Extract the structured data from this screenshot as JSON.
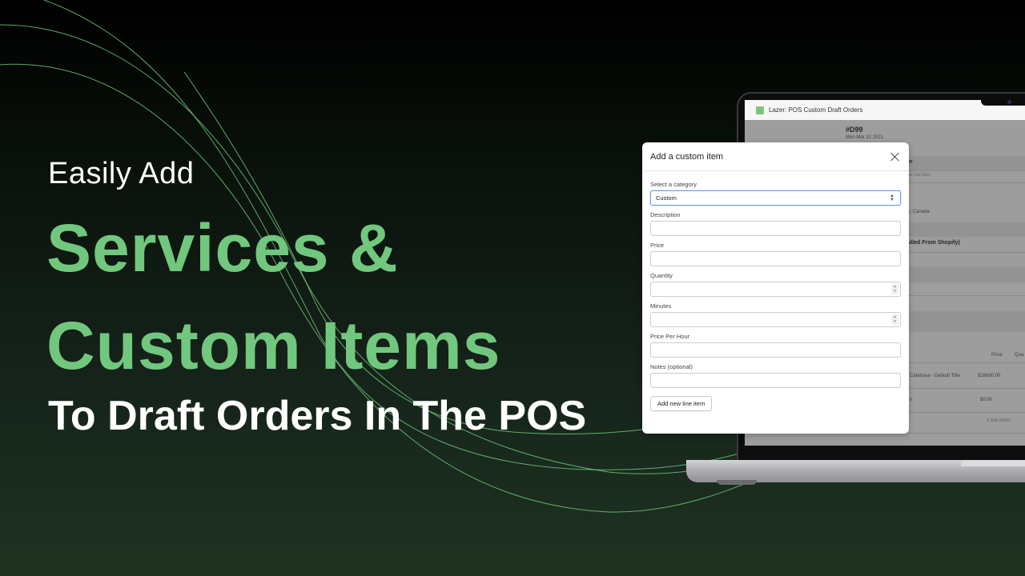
{
  "hero": {
    "eyebrow": "Easily Add",
    "headline_line1": "Services &",
    "headline_line2": "Custom Items",
    "subheadline": "To Draft Orders In The POS",
    "colors": {
      "accent": "#72c77e",
      "text": "#ffffff",
      "background_top": "#000000",
      "background_bottom": "#1f3322"
    }
  },
  "app": {
    "title": "Lazer: POS Custom Draft Orders",
    "icon": "app-logo-icon",
    "order": {
      "number": "#D99",
      "date": "Mon Mar 22 2021"
    },
    "background_fragments": {
      "customer_heading_fragment": "er",
      "phone_placeholder_fragment": "ne number",
      "address_fragment": "n, Canada",
      "pulled_heading_fragment": "ulled From Shopify)",
      "price_column": "Price",
      "quantity_column_fragment": "Qua",
      "line_items": [
        {
          "title_fragment": "Calatrava - Default Title",
          "price": "$28690.00"
        },
        {
          "title_fragment": "ir",
          "price": "$0.00"
        }
      ],
      "line_items_count": "2 line items"
    }
  },
  "modal": {
    "title": "Add a custom item",
    "close_icon": "close-icon",
    "fields": [
      {
        "label": "Select a category",
        "type": "select",
        "value": "Custom"
      },
      {
        "label": "Description",
        "type": "text",
        "value": ""
      },
      {
        "label": "Price",
        "type": "text",
        "value": ""
      },
      {
        "label": "Quantity",
        "type": "number",
        "value": ""
      },
      {
        "label": "Minutes",
        "type": "number",
        "value": ""
      },
      {
        "label": "Price Per Hour",
        "type": "text",
        "value": ""
      },
      {
        "label": "Notes (optional)",
        "type": "text",
        "value": ""
      }
    ],
    "submit_label": "Add new line item",
    "focus_color": "#7b9ce6"
  }
}
